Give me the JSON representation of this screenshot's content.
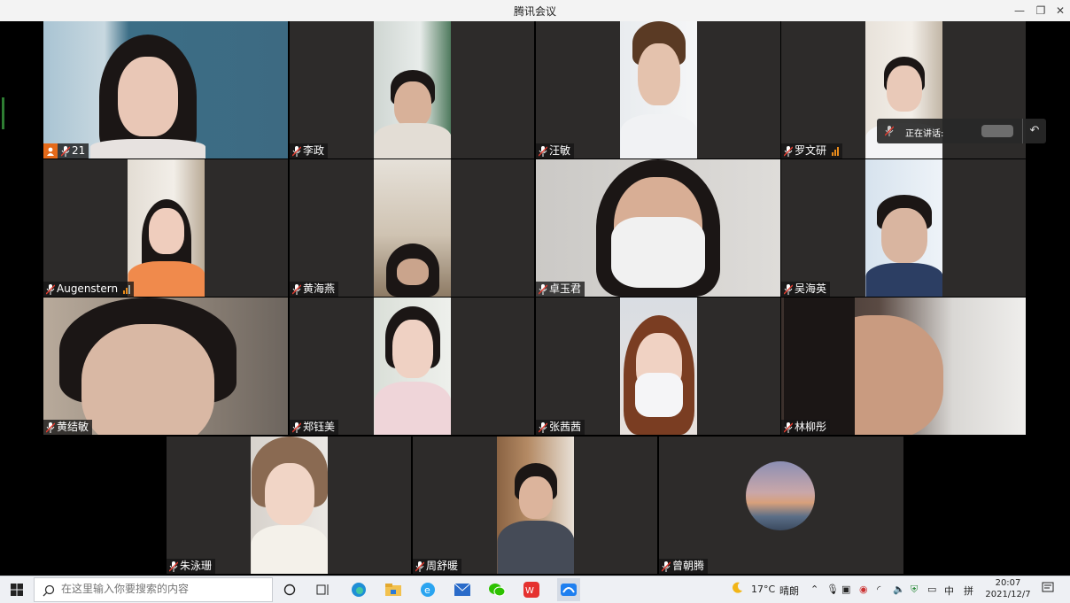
{
  "window": {
    "title": "腾讯会议",
    "minimize": "—",
    "restore": "❐",
    "close": "✕"
  },
  "speaking": {
    "label": "正在讲话:"
  },
  "participants": [
    {
      "name": "21",
      "host": true
    },
    {
      "name": "李政"
    },
    {
      "name": "汪敏"
    },
    {
      "name": "罗文研",
      "signal": true
    },
    {
      "name": "Augenstern",
      "signal": true
    },
    {
      "name": "黄海燕"
    },
    {
      "name": "卓玉君"
    },
    {
      "name": "吴海英"
    },
    {
      "name": "黄结敏"
    },
    {
      "name": "郑钰美"
    },
    {
      "name": "张茜茜"
    },
    {
      "name": "林柳彤"
    },
    {
      "name": "朱泳珊"
    },
    {
      "name": "周舒暖"
    },
    {
      "name": "曾朝腾"
    }
  ],
  "taskbar": {
    "search_placeholder": "在这里输入你要搜索的内容",
    "weather_temp": "17°C",
    "weather_desc": "晴朗",
    "ime_lang": "中",
    "ime_mode": "拼",
    "time": "20:07",
    "date": "2021/12/7"
  },
  "colors": {
    "tile_bg": "#2d2b2a",
    "host_badge": "#e46a1a",
    "signal": "#e98b1b",
    "mic": "#e03a2e"
  }
}
